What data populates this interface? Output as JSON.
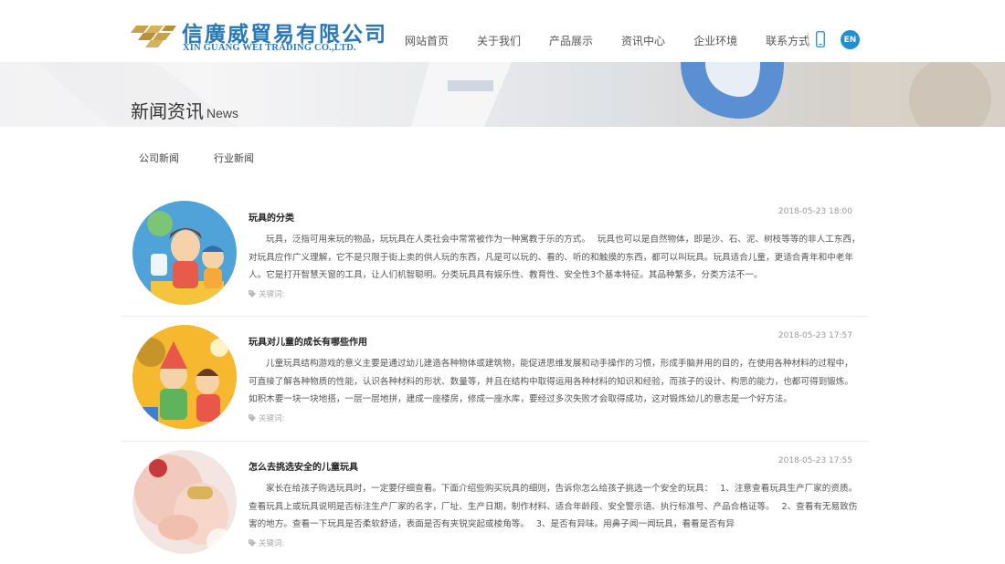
{
  "header": {
    "logo_cn": "信廣威貿易有限公司",
    "logo_en": "XIN GUANG WEI TRADING CO.,LTD.",
    "nav": [
      "网站首页",
      "关于我们",
      "产品展示",
      "资讯中心",
      "企业环境",
      "联系方式"
    ],
    "lang_badge": "EN",
    "icons": [
      "logo-mark-icon",
      "phone-icon"
    ]
  },
  "banner": {
    "title": "新闻资讯",
    "subtitle": "News"
  },
  "tabs": [
    "公司新闻",
    "行业新闻"
  ],
  "news": [
    {
      "title": "玩具的分类",
      "date": "2018-05-23 18:00",
      "body": "玩具，泛指可用来玩的物品，玩玩具在人类社会中常常被作为一种寓教于乐的方式。　 玩具也可以是自然物体，即是沙、石、泥、树枝等等的非人工东西，对玩具应作广义理解，它不是只限于街上卖的供人玩的东西，凡是可以玩的、看的、听的和触摸的东西，都可以叫玩具。玩具适合儿童，更适合青年和中老年人。它是打开智慧天窗的工具，让人们机智聪明。分类玩具具有娱乐性、教育性、安全性3个基本特征。其品种繁多，分类方法不一。",
      "tag_label": "关键词:"
    },
    {
      "title": "玩具对儿童的成长有哪些作用",
      "date": "2018-05-23 17:57",
      "body": "儿童玩具结构游戏的意义主要是通过幼儿建造各种物体或建筑物，能促进思维发展和动手操作的习惯，形成手脑并用的目的，在使用各种材料的过程中，可直接了解各种物质的性能，认识各种材料的形状、数量等，并且在结构中取得运用各种材料的知识和经验，而孩子的设计、构思的能力，也都可得到锻炼。如积木要一块一块地搭，一层一层地拼，建成一座楼房，修成一座水库，要经过多次失败才会取得成功，这对锻炼幼儿的意志是一个好方法。",
      "tag_label": "关键词:"
    },
    {
      "title": "怎么去挑选安全的儿童玩具",
      "date": "2018-05-23 17:55",
      "body": "家长在给孩子购选玩具时，一定要仔细查看。下面介绍些购买玩具的细则，告诉你怎么给孩子挑选一个安全的玩具：　 1、注意查看玩具生产厂家的资质。查看玩具上或玩具说明是否标注生产厂家的名字，厂址、生产日期，制作材料、适合年龄段、安全警示语、执行标准号、产品合格证等。　 2、查看有无易致伤害的地方。查看一下玩具是否柔软舒适，表面是否有夹锐突起或棱角等。　 3、是否有异味。用鼻子闻一闻玩具，看看是否有异",
      "tag_label": "关键词:"
    }
  ],
  "colors": {
    "brand_blue": "#2a78b8",
    "logo_gold": "#c8a24a",
    "en_badge": "#1f8fd3"
  }
}
